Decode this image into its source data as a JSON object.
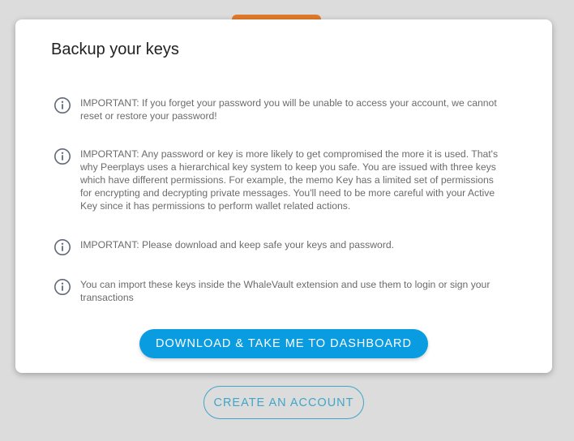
{
  "colors": {
    "page_background": "#dcdcdc",
    "accent_tab": "#e07a2c",
    "primary_button": "#0a9ce0",
    "outline_button": "#3fa6c8",
    "notice_text": "#6b6b6b",
    "icon": "#5f6b7a"
  },
  "modal": {
    "title": "Backup your keys",
    "notices": [
      {
        "icon": "info-circle-icon",
        "text": "IMPORTANT: If you forget your password you will be unable to access your account, we cannot reset or restore your password!"
      },
      {
        "icon": "info-circle-icon",
        "text": "IMPORTANT: Any password or key is more likely to get compromised the more it is used. That's why Peerplays uses a hierarchical key system to keep you safe. You are issued with three keys which have different permissions. For example, the memo Key has a limited set of permissions for encrypting and decrypting private messages. You'll need to be more careful with your Active Key since it has permissions to perform wallet related actions."
      },
      {
        "icon": "info-circle-icon",
        "text": "IMPORTANT: Please download and keep safe your keys and password."
      },
      {
        "icon": "info-circle-icon",
        "text": "You can import these keys inside the WhaleVault extension and use them to login or sign your transactions"
      }
    ],
    "download_button_label": "DOWNLOAD & TAKE ME TO DASHBOARD"
  },
  "create_account_button_label": "CREATE AN ACCOUNT"
}
